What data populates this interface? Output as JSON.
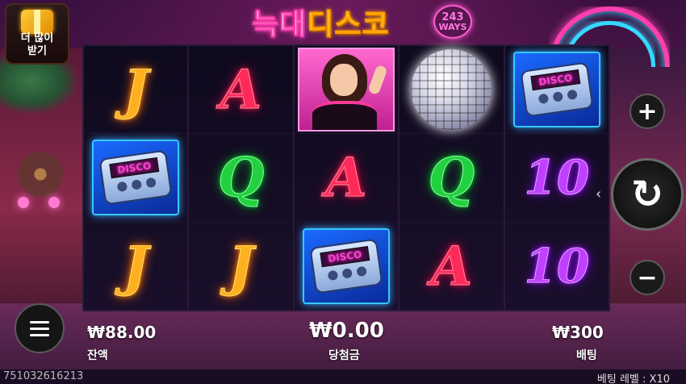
{
  "title": {
    "part1": "늑대",
    "part2": "디스코",
    "ways_number": "243",
    "ways_label": "WAYS"
  },
  "get_more": {
    "line1": "더 많이",
    "line2": "받기"
  },
  "reels": [
    [
      "J",
      "pager",
      "J"
    ],
    [
      "A",
      "Q",
      "J"
    ],
    [
      "dancer",
      "A",
      "pager"
    ],
    [
      "discoball",
      "Q",
      "A"
    ],
    [
      "pager",
      "10",
      "10"
    ]
  ],
  "symbols": {
    "J": "J",
    "A": "A",
    "Q": "Q",
    "10": "10",
    "pager_screen": "DISCO"
  },
  "icons": {
    "plus": "+",
    "minus": "−",
    "spin": "↻",
    "arrow": "‹"
  },
  "balance": {
    "value": "₩88.00",
    "label": "잔액"
  },
  "win": {
    "value": "₩0.00",
    "label": "당첨금"
  },
  "bet": {
    "value": "₩300",
    "label": "배팅"
  },
  "footer": {
    "round_id": "751032616213",
    "bet_level": "베팅 레벨 : X10"
  },
  "colors": {
    "J": "#ffb020",
    "A": "#ff2a5a",
    "Q": "#22d040",
    "10": "#c040ff",
    "neon_pink": "#ff3fae",
    "neon_blue": "#35d8ff"
  }
}
